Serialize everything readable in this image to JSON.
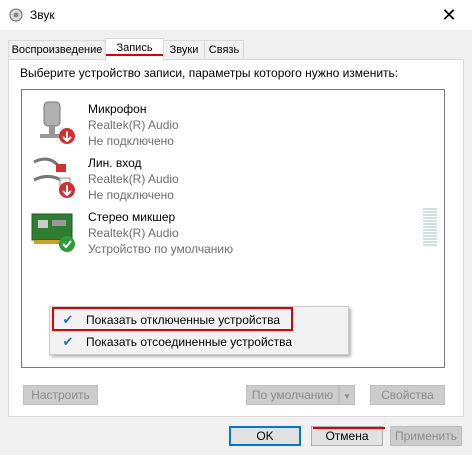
{
  "window": {
    "title": "Звук",
    "close_glyph": "✕"
  },
  "tabs": [
    {
      "label": "Воспроизведение"
    },
    {
      "label": "Запись"
    },
    {
      "label": "Звуки"
    },
    {
      "label": "Связь"
    }
  ],
  "instruction": "Выберите устройство записи, параметры которого нужно изменить:",
  "devices": [
    {
      "name": "Микрофон",
      "driver": "Realtek(R) Audio",
      "status": "Не подключено",
      "icon": "microphone-icon",
      "badge": "disconnected-badge"
    },
    {
      "name": "Лин. вход",
      "driver": "Realtek(R) Audio",
      "status": "Не подключено",
      "icon": "line-in-cable-icon",
      "badge": "disconnected-badge"
    },
    {
      "name": "Стерео микшер",
      "driver": "Realtek(R) Audio",
      "status": "Устройство по умолчанию",
      "icon": "sound-card-icon",
      "badge": "default-device-badge"
    }
  ],
  "context_menu": {
    "items": [
      {
        "label": "Показать отключенные устройства",
        "checked": true
      },
      {
        "label": "Показать отсоединенные устройства",
        "checked": true
      }
    ]
  },
  "panel_buttons": {
    "configure": "Настроить",
    "set_default": "По умолчанию",
    "properties": "Свойства"
  },
  "dialog_buttons": {
    "ok": "OK",
    "cancel": "Отмена",
    "apply": "Применить"
  },
  "colors": {
    "highlight_red": "#e00000",
    "accent_blue": "#0078d7",
    "disabled_gray": "#8d8d8d"
  }
}
